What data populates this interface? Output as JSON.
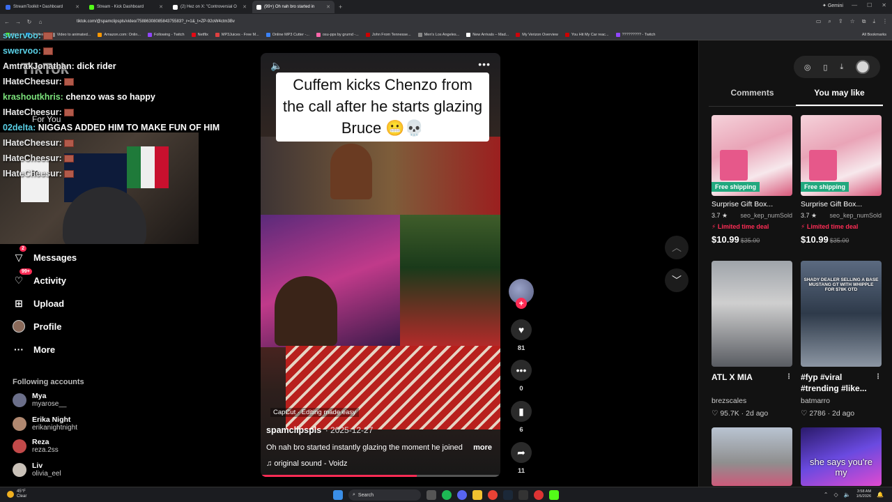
{
  "browser": {
    "tabs": [
      {
        "label": "StreamToolkit • Dashboard",
        "color": "#3a6df0"
      },
      {
        "label": "Stream - Kick Dashboard",
        "color": "#53fc18"
      },
      {
        "label": "(2) Hez on X: \"Controversial O",
        "color": "#ffffff"
      },
      {
        "label": "(99+) Oh nah bro started in",
        "color": "#ffffff"
      }
    ],
    "gemini_label": "Gemini",
    "url": "tiktok.com/@spamclipspls/video/7588630808584375583?_r=1&_t=ZP-92oW4ctm3Bv",
    "bookmarks": [
      {
        "label": "Kick",
        "color": "#53fc18"
      },
      {
        "label": "Twitter",
        "color": "#1d9bf0"
      },
      {
        "label": "Video to animated...",
        "color": "#888888"
      },
      {
        "label": "Amazon.com: Onlin...",
        "color": "#ff9900"
      },
      {
        "label": "Following - Twitch",
        "color": "#9146ff"
      },
      {
        "label": "Netflix",
        "color": "#e50914"
      },
      {
        "label": "MP3Juices - Free M...",
        "color": "#e04040"
      },
      {
        "label": "Online MP3 Cutter -...",
        "color": "#3b82f6"
      },
      {
        "label": "osu-pps by grumd -...",
        "color": "#ff66aa"
      },
      {
        "label": "John From Tennesse...",
        "color": "#cc0000"
      },
      {
        "label": "Men's Los Angeles...",
        "color": "#888888"
      },
      {
        "label": "New Arrivals – Mad...",
        "color": "#ffffff"
      },
      {
        "label": "My Verizon Overview",
        "color": "#cd040b"
      },
      {
        "label": "You Hit My Car reac...",
        "color": "#cc0000"
      },
      {
        "label": "????????? - Twitch",
        "color": "#9146ff"
      }
    ],
    "all_bookmarks": "All Bookmarks"
  },
  "chat": [
    {
      "user": "swervoo:",
      "msg": "",
      "cls": "cyan",
      "emote": true
    },
    {
      "user": "swervoo:",
      "msg": "",
      "cls": "cyan",
      "emote": true
    },
    {
      "user": "AmtrakJonathan:",
      "msg": "dick rider",
      "cls": "",
      "emote": false
    },
    {
      "user": "IHateCheesur:",
      "msg": "",
      "cls": "",
      "emote": true
    },
    {
      "user": "krashoutkhris:",
      "msg": "chenzo was so happy",
      "cls": "green",
      "emote": false
    },
    {
      "user": "IHateCheesur:",
      "msg": "",
      "cls": "",
      "emote": true
    },
    {
      "user": "02delta:",
      "msg": "NIGGAS ADDED HIM TO MAKE FUN OF HIM",
      "cls": "cyan",
      "emote": false
    },
    {
      "user": "IHateCheesur:",
      "msg": "",
      "cls": "",
      "emote": true
    },
    {
      "user": "IHateCheesur:",
      "msg": "",
      "cls": "",
      "emote": true
    },
    {
      "user": "IHateCheesur:",
      "msg": "",
      "cls": "",
      "emote": true
    }
  ],
  "sidebar": {
    "logo": "TikTok",
    "for_you": "For You",
    "nav": [
      {
        "label": "Messages",
        "icon": "messages-icon",
        "glyph": "▽",
        "badge": "2"
      },
      {
        "label": "Activity",
        "icon": "activity-icon",
        "glyph": "♡",
        "badge": "99+"
      },
      {
        "label": "Upload",
        "icon": "upload-icon",
        "glyph": "⊞",
        "badge": ""
      },
      {
        "label": "Profile",
        "icon": "profile-icon",
        "glyph": "",
        "badge": ""
      },
      {
        "label": "More",
        "icon": "more-icon",
        "glyph": "···",
        "badge": ""
      }
    ],
    "following_title": "Following accounts",
    "accounts": [
      {
        "name": "Mya",
        "handle": "myarose__",
        "color": "#6b6f8a"
      },
      {
        "name": "Erika Night",
        "handle": "erikanightnight",
        "color": "#b08870"
      },
      {
        "name": "Reza",
        "handle": "reza.2ss",
        "color": "#c24a4a"
      },
      {
        "name": "Liv",
        "handle": "olivia_eel",
        "color": "#c9c1b8"
      }
    ]
  },
  "video": {
    "caption": "Cuffem kicks Chenzo from the call after he starts glazing Bruce 😬💀",
    "capcut_label": "CapCut · Editing made easy",
    "author": "spamclipspls",
    "date": "· 2025-12-27",
    "description": "Oh nah bro started instantly glazing the moment he joined",
    "more": "more",
    "sound": "original sound - Voidz",
    "progress": 0.65
  },
  "actions": {
    "likes": "81",
    "comments": "0",
    "bookmarks": "6",
    "shares": "11"
  },
  "right_panel": {
    "tabs": [
      "Comments",
      "You may like"
    ],
    "active_tab": 1,
    "products": [
      {
        "title": "Surprise Gift Box...",
        "rating": "3.7 ★",
        "sold": "seo_kep_numSold",
        "badge": "Free shipping",
        "deal": "Limited time deal",
        "price": "$10.99",
        "old_price": "$35.00"
      },
      {
        "title": "Surprise Gift Box...",
        "rating": "3.7 ★",
        "sold": "seo_kep_numSold",
        "badge": "Free shipping",
        "deal": "Limited time deal",
        "price": "$10.99",
        "old_price": "$35.00"
      }
    ],
    "videos": [
      {
        "title": "ATL X MIA",
        "author": "brezscales",
        "stats": "♡ 95.7K · 2d ago",
        "overlay": ""
      },
      {
        "title": "#fyp #viral #trending #like...",
        "author": "batmarro",
        "stats": "♡ 2786 · 2d ago",
        "overlay": "SHADY DEALER SELLING A BASE MUSTANG GT WITH WHIPPLE FOR $78K OTD"
      }
    ],
    "bottom_thumbs": [
      {
        "overlay": ""
      },
      {
        "overlay": "she says you're my"
      }
    ]
  },
  "taskbar": {
    "weather_temp": "45°F",
    "weather_desc": "Clear",
    "search": "Search",
    "time": "3:58 AM",
    "date": "1/5/2026"
  }
}
